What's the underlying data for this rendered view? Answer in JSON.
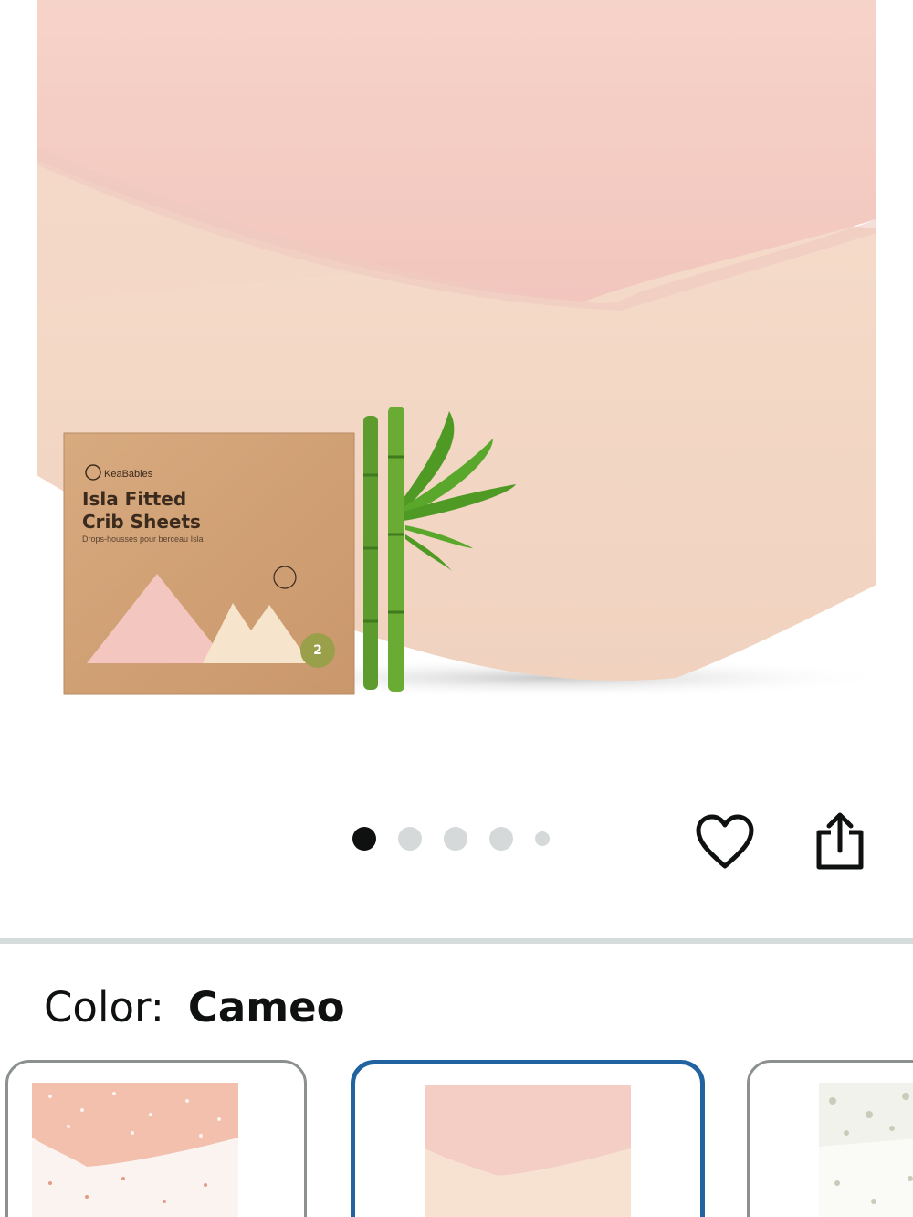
{
  "product": {
    "image_alt": "KeaBabies Isla Fitted Crib Sheets - Cameo",
    "box_brand": "KeaBabies",
    "box_title_line1": "Isla Fitted",
    "box_title_line2": "Crib Sheets",
    "box_subtitle": "Drops-housses pour berceau Isla",
    "box_pack_count": "2"
  },
  "carousel": {
    "total_dots": 5,
    "active_index": 0
  },
  "actions": {
    "wishlist_icon": "heart-outline-icon",
    "share_icon": "share-icon"
  },
  "variation": {
    "label": "Color:",
    "selected_value": "Cameo"
  },
  "colors": {
    "accent": "#2162a1",
    "text": "#0f1111",
    "dot_inactive": "#d5d9d9",
    "divider": "#d5dbdb"
  }
}
